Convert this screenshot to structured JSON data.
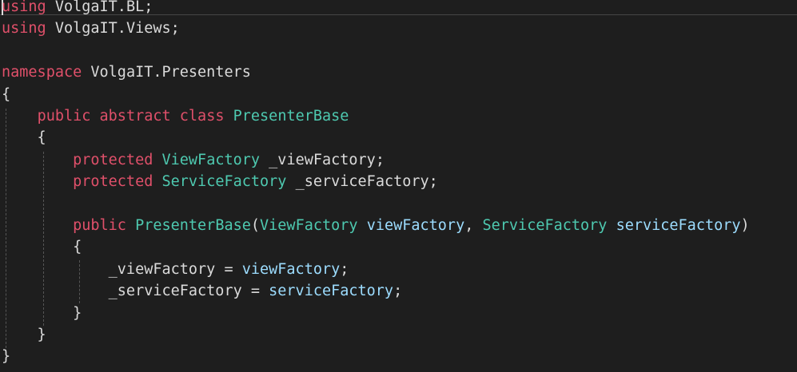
{
  "editor": {
    "colors": {
      "background": "#1e1e1e",
      "keyword": "#e0506a",
      "type": "#4ec9b0",
      "parameter": "#9cdcfe",
      "text": "#dadada"
    },
    "lines": [
      {
        "tokens": [
          {
            "t": "using",
            "c": "kw2"
          },
          {
            "t": " VolgaIT.BL;",
            "c": "plain"
          }
        ]
      },
      {
        "tokens": [
          {
            "t": "using",
            "c": "kw2"
          },
          {
            "t": " VolgaIT.Views;",
            "c": "plain"
          }
        ]
      },
      {
        "tokens": []
      },
      {
        "tokens": [
          {
            "t": "namespace",
            "c": "kw2"
          },
          {
            "t": " VolgaIT.Presenters",
            "c": "plain"
          }
        ]
      },
      {
        "tokens": [
          {
            "t": "{",
            "c": "plain"
          }
        ]
      },
      {
        "tokens": [
          {
            "t": "    ",
            "c": "plain"
          },
          {
            "t": "public",
            "c": "kw2"
          },
          {
            "t": " ",
            "c": "plain"
          },
          {
            "t": "abstract",
            "c": "kw2"
          },
          {
            "t": " ",
            "c": "plain"
          },
          {
            "t": "class",
            "c": "kw2"
          },
          {
            "t": " ",
            "c": "plain"
          },
          {
            "t": "PresenterBase",
            "c": "type"
          }
        ]
      },
      {
        "tokens": [
          {
            "t": "    {",
            "c": "plain"
          }
        ]
      },
      {
        "tokens": [
          {
            "t": "        ",
            "c": "plain"
          },
          {
            "t": "protected",
            "c": "kw2"
          },
          {
            "t": " ",
            "c": "plain"
          },
          {
            "t": "ViewFactory",
            "c": "type"
          },
          {
            "t": " _viewFactory;",
            "c": "plain"
          }
        ]
      },
      {
        "tokens": [
          {
            "t": "        ",
            "c": "plain"
          },
          {
            "t": "protected",
            "c": "kw2"
          },
          {
            "t": " ",
            "c": "plain"
          },
          {
            "t": "ServiceFactory",
            "c": "type"
          },
          {
            "t": " _serviceFactory;",
            "c": "plain"
          }
        ]
      },
      {
        "tokens": []
      },
      {
        "tokens": [
          {
            "t": "        ",
            "c": "plain"
          },
          {
            "t": "public",
            "c": "kw2"
          },
          {
            "t": " ",
            "c": "plain"
          },
          {
            "t": "PresenterBase",
            "c": "type"
          },
          {
            "t": "(",
            "c": "plain"
          },
          {
            "t": "ViewFactory",
            "c": "type"
          },
          {
            "t": " ",
            "c": "plain"
          },
          {
            "t": "viewFactory",
            "c": "param"
          },
          {
            "t": ", ",
            "c": "plain"
          },
          {
            "t": "ServiceFactory",
            "c": "type"
          },
          {
            "t": " ",
            "c": "plain"
          },
          {
            "t": "serviceFactory",
            "c": "param"
          },
          {
            "t": ")",
            "c": "plain"
          }
        ]
      },
      {
        "tokens": [
          {
            "t": "        {",
            "c": "plain"
          }
        ]
      },
      {
        "tokens": [
          {
            "t": "            _viewFactory = ",
            "c": "plain"
          },
          {
            "t": "viewFactory",
            "c": "param"
          },
          {
            "t": ";",
            "c": "plain"
          }
        ]
      },
      {
        "tokens": [
          {
            "t": "            _serviceFactory = ",
            "c": "plain"
          },
          {
            "t": "serviceFactory",
            "c": "param"
          },
          {
            "t": ";",
            "c": "plain"
          }
        ]
      },
      {
        "tokens": [
          {
            "t": "        }",
            "c": "plain"
          }
        ]
      },
      {
        "tokens": [
          {
            "t": "    }",
            "c": "plain"
          }
        ]
      },
      {
        "tokens": [
          {
            "t": "}",
            "c": "plain"
          }
        ]
      }
    ]
  }
}
